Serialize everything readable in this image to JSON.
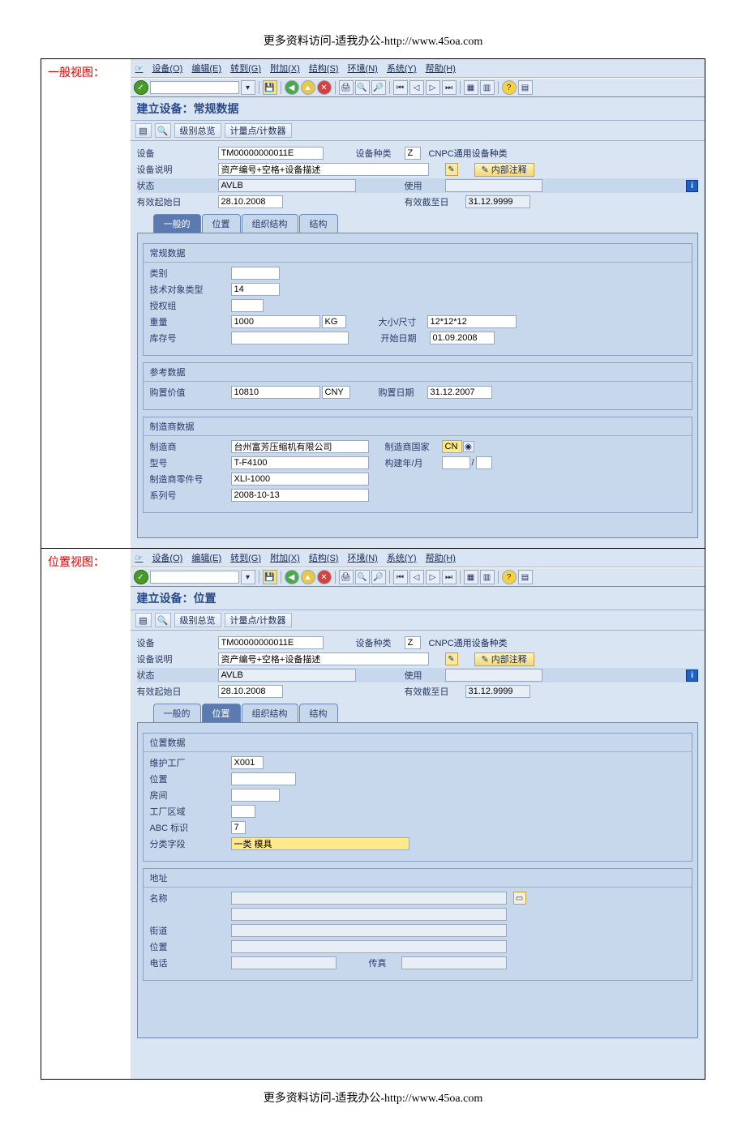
{
  "header": "更多资料访问-适我办公-http://www.45oa.com",
  "footer": "更多资料访问-适我办公-http://www.45oa.com",
  "sections": {
    "general": {
      "label": "一般视图："
    },
    "location": {
      "label": "位置视图："
    }
  },
  "menu": {
    "items": [
      "设备(O)",
      "编辑(E)",
      "转到(G)",
      "附加(X)",
      "结构(S)",
      "环境(N)",
      "系统(Y)",
      "帮助(H)"
    ]
  },
  "app_toolbar": {
    "class_overview": "级别总览",
    "measuring_points": "计量点/计数器"
  },
  "common_fields": {
    "equipment_label": "设备",
    "equipment_value": "TM00000000011E",
    "category_label": "设备种类",
    "category_value": "Z",
    "category_text": "CNPC通用设备种类",
    "description_label": "设备说明",
    "description_value": "资产编号+空格+设备描述",
    "internal_notes": "内部注释",
    "status_label": "状态",
    "status_value": "AVLB",
    "status_use_label": "使用",
    "valid_from_label": "有效起始日",
    "valid_from_value": "28.10.2008",
    "valid_to_label": "有效截至日",
    "valid_to_value": "31.12.9999"
  },
  "tabs": {
    "general": "一般的",
    "location": "位置",
    "organization": "组织结构",
    "structure": "结构"
  },
  "view1": {
    "title": "建立设备：常规数据",
    "group_general_title": "常规数据",
    "category_label": "类别",
    "object_type_label": "技术对象类型",
    "object_type_value": "14",
    "auth_group_label": "授权组",
    "weight_label": "重量",
    "weight_value": "1000",
    "weight_unit": "KG",
    "size_label": "大小/尺寸",
    "size_value": "12*12*12",
    "inventory_label": "库存号",
    "start_date_label": "开始日期",
    "start_date_value": "01.09.2008",
    "group_ref_title": "参考数据",
    "acquisition_value_label": "购置价值",
    "acquisition_value": "10810",
    "currency": "CNY",
    "acquisition_date_label": "购置日期",
    "acquisition_date_value": "31.12.2007",
    "group_mfr_title": "制造商数据",
    "manufacturer_label": "制造商",
    "manufacturer_value": "台州富芳压缩机有限公司",
    "mfr_country_label": "制造商国家",
    "mfr_country_value": "CN",
    "model_label": "型号",
    "model_value": "T-F4100",
    "constr_year_label": "构建年/月",
    "constr_year_sep": "/",
    "part_no_label": "制造商零件号",
    "part_no_value": "XLI-1000",
    "serial_label": "系列号",
    "serial_value": "2008-10-13"
  },
  "view2": {
    "title": "建立设备：位置",
    "group_loc_title": "位置数据",
    "maint_plant_label": "维护工厂",
    "maint_plant_value": "X001",
    "location_label": "位置",
    "room_label": "房间",
    "plant_section_label": "工厂区域",
    "abc_label": "ABC 标识",
    "abc_value": "7",
    "sort_field_label": "分类字段",
    "sort_field_value": "一类 模具",
    "group_addr_title": "地址",
    "name_label": "名称",
    "street_label": "街道",
    "loc2_label": "位置",
    "phone_label": "电话",
    "fax_label": "传真"
  }
}
